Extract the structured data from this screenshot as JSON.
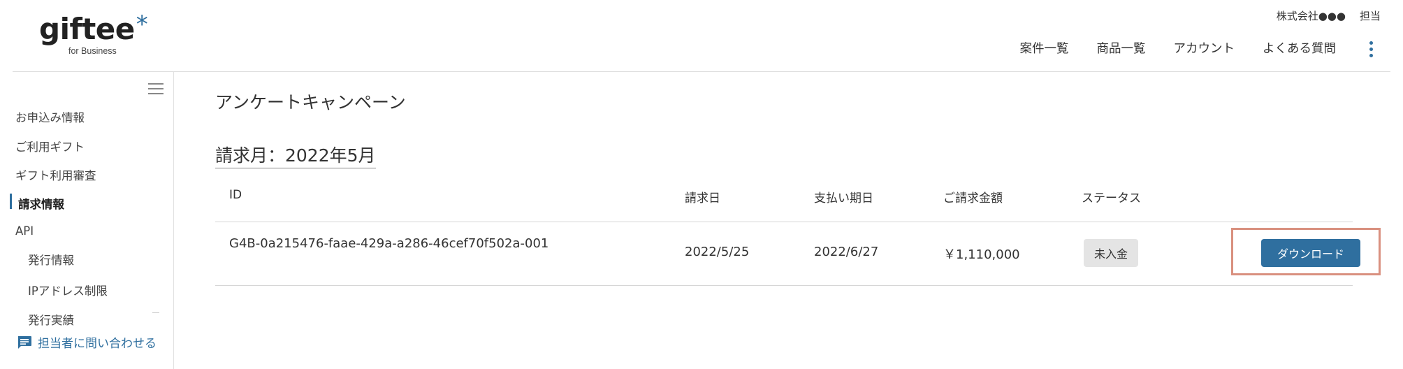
{
  "brand": {
    "name": "giftee",
    "star": "*",
    "sub": "for Business"
  },
  "user": {
    "company": "株式会社●●●",
    "role": "担当"
  },
  "nav": {
    "items": [
      "案件一覧",
      "商品一覧",
      "アカウント",
      "よくある質問"
    ]
  },
  "sidebar": {
    "items": [
      "お申込み情報",
      "ご利用ギフト",
      "ギフト利用審査",
      "請求情報",
      "API"
    ],
    "sub_items": [
      "発行情報",
      "IPアドレス制限",
      "発行実績"
    ],
    "active": "請求情報",
    "contact_label": "担当者に問い合わせる"
  },
  "page": {
    "title": "アンケートキャンペーン",
    "billing_month": "請求月：2022年5月"
  },
  "table": {
    "headers": [
      "ID",
      "請求日",
      "支払い期日",
      "ご請求金額",
      "ステータス"
    ],
    "rows": [
      {
        "id": "G4B-0a215476-faae-429a-a286-46cef70f502a-001",
        "billing_date": "2022/5/25",
        "due_date": "2022/6/27",
        "amount": "￥1,110,000",
        "status": "未入金",
        "action": "ダウンロード"
      }
    ]
  },
  "colors": {
    "accent": "#2f6f9f",
    "highlight": "#d9907f",
    "badge_bg": "#e4e4e4"
  }
}
